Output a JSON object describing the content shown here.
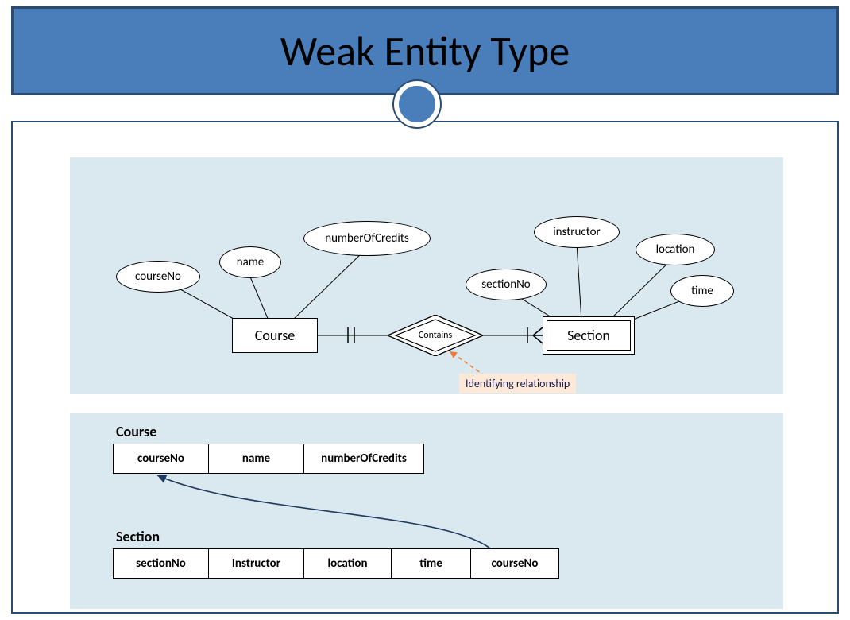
{
  "title": "Weak Entity Type",
  "er": {
    "strongEntity": "Course",
    "weakEntity": "Section",
    "relationship": "Contains",
    "note": "Identifying relationship",
    "attrs": {
      "courseNo": "courseNo",
      "name": "name",
      "numberOfCredits": "numberOfCredits",
      "sectionNo": "sectionNo",
      "instructor": "instructor",
      "location": "location",
      "time": "time"
    }
  },
  "schema": {
    "courseTitle": "Course",
    "sectionTitle": "Section",
    "course": {
      "c0": "courseNo",
      "c1": "name",
      "c2": "numberOfCredits"
    },
    "section": {
      "c0": "sectionNo",
      "c1": "Instructor",
      "c2": "location",
      "c3": "time",
      "c4": "courseNo"
    }
  }
}
